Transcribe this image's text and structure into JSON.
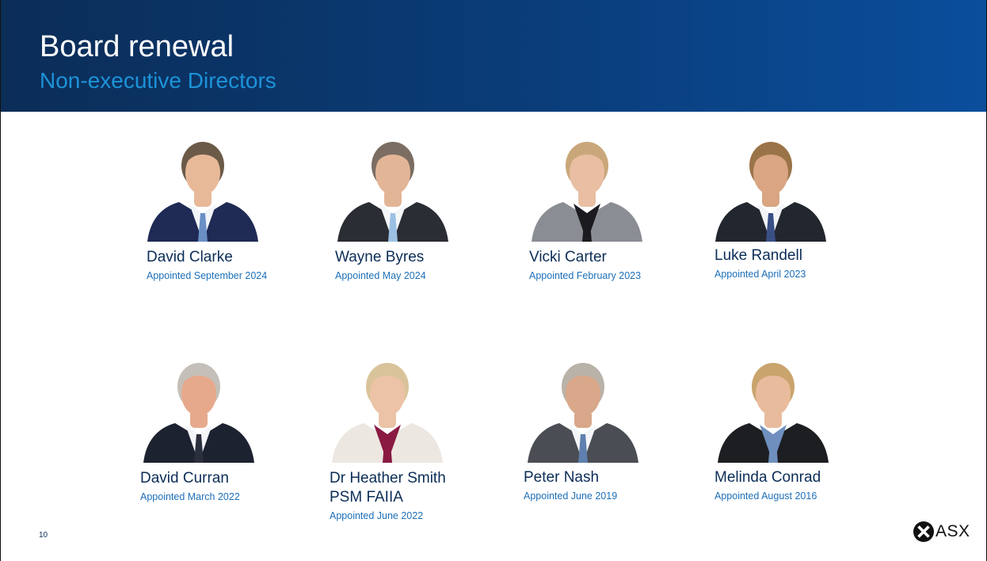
{
  "header": {
    "title": "Board renewal",
    "subtitle": "Non-executive Directors"
  },
  "directors": [
    {
      "name": "David Clarke",
      "appointed": "Appointed  September 2024",
      "suit": "#1f2a55",
      "shirt": "#f1f4f8",
      "tie": "#6a8fc6",
      "hair": "#6b5a48",
      "skin": "#e8b999"
    },
    {
      "name": "Wayne Byres",
      "appointed": "Appointed May 2024",
      "suit": "#2a2d33",
      "shirt": "#f4f6f8",
      "tie": "#9cc0e4",
      "hair": "#7b6d62",
      "skin": "#e3b597"
    },
    {
      "name": "Vicki Carter",
      "appointed": "Appointed February 2023",
      "suit": "#8a8d93",
      "shirt": "#1b1b1f",
      "tie": "#1b1b1f",
      "hair": "#c9a77a",
      "skin": "#e9bea2"
    },
    {
      "name": "Luke Randell",
      "appointed": "Appointed April 2023",
      "suit": "#22262e",
      "shirt": "#f2f4f7",
      "tie": "#3a4f86",
      "hair": "#9a7448",
      "skin": "#d9a583"
    },
    {
      "name": "David Curran",
      "appointed": "Appointed  March 2022",
      "suit": "#1d2230",
      "shirt": "#f3f5f8",
      "tie": "#2b2f3d",
      "hair": "#c4bfb8",
      "skin": "#e7a98c"
    },
    {
      "name_lines": [
        "Dr Heather Smith",
        "PSM FAIIA"
      ],
      "appointed": "Appointed June 2022",
      "suit": "#ece7e1",
      "shirt": "#8a1a42",
      "tie": "#8a1a42",
      "hair": "#d9c39b",
      "skin": "#ecc3a7"
    },
    {
      "name": "Peter Nash",
      "appointed": "Appointed June 2019",
      "suit": "#4a4d53",
      "shirt": "#f3f5f8",
      "tie": "#5f7fae",
      "hair": "#b9b2a8",
      "skin": "#d9a88a"
    },
    {
      "name": "Melinda Conrad",
      "appointed": "Appointed August 2016",
      "suit": "#1d1e22",
      "shirt": "#6f8fbf",
      "tie": "#6f8fbf",
      "hair": "#c9a46c",
      "skin": "#e9bb9d"
    }
  ],
  "page_number": "10",
  "logo": {
    "text": "ASX"
  }
}
